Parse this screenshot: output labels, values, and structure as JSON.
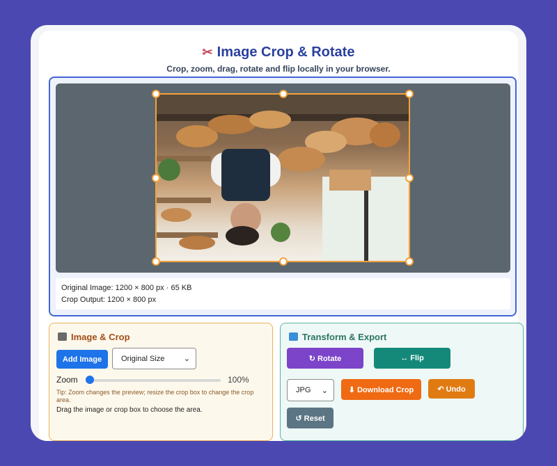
{
  "header": {
    "title": "Image Crop & Rotate",
    "title_icon": "scissors-icon",
    "subtitle": "Crop, zoom, drag, rotate and flip locally in your browser."
  },
  "editor": {
    "info_original": "Original Image: 1200 × 800 px · 65 KB",
    "info_output": "Crop Output: 1200 × 800 px"
  },
  "image_panel": {
    "title": "Image & Crop",
    "add_image": "Add Image",
    "size_select": "Original Size",
    "zoom_label": "Zoom",
    "zoom_value": "100%",
    "zoom_level": 0,
    "tip": "Tip: Zoom changes the preview; resize the crop box to change the crop area.",
    "drag_note": "Drag the image or crop box to choose the area."
  },
  "transform_panel": {
    "title": "Transform & Export",
    "rotate": "↻ Rotate",
    "flip": "↔ Flip",
    "format_select": "JPG",
    "download": "⬇ Download Crop",
    "undo": "↶ Undo",
    "reset": "↺ Reset"
  },
  "colors": {
    "background": "#4b48b2",
    "rotate": "#7b44c9",
    "flip": "#14897a",
    "download": "#ef6a12",
    "undo": "#e07b12",
    "reset": "#5b7584",
    "add_image": "#1e73e8",
    "crop_border": "#f2a23a"
  }
}
